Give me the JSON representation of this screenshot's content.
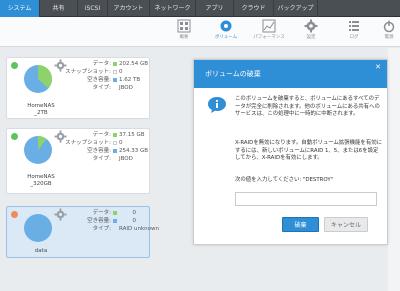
{
  "nav": {
    "tabs": [
      {
        "label": "システム",
        "active": true
      },
      {
        "label": "共有",
        "active": false
      },
      {
        "label": "iSCSI",
        "active": false
      },
      {
        "label": "アカウント",
        "active": false
      },
      {
        "label": "ネットワーク",
        "active": false
      },
      {
        "label": "アプリ",
        "active": false
      },
      {
        "label": "クラウド",
        "active": false
      },
      {
        "label": "バックアップ",
        "active": false
      }
    ]
  },
  "toolbar": {
    "items": [
      {
        "label": "概要",
        "icon": "overview-icon"
      },
      {
        "label": "ボリューム",
        "icon": "volume-icon",
        "active": true
      },
      {
        "label": "パフォーマンス",
        "icon": "performance-icon"
      },
      {
        "label": "設定",
        "icon": "settings-icon"
      },
      {
        "label": "ログ",
        "icon": "logs-icon"
      },
      {
        "label": "電源",
        "icon": "power-icon"
      }
    ]
  },
  "volumes": [
    {
      "name": "HomeNAS\n_2TB",
      "status_color": "#5cc45c",
      "stats": [
        {
          "label": "データ:",
          "value": "202.54 GB",
          "color": "#8ed26b"
        },
        {
          "label": "スナップショット:",
          "value": "0",
          "color": "#ffffff"
        },
        {
          "label": "空き容量:",
          "value": "1.62 TB",
          "color": "#6aaee6"
        },
        {
          "label": "タイプ:",
          "value": "JBOD",
          "color": ""
        }
      ]
    },
    {
      "name": "HomeNAS\n_320GB",
      "status_color": "#5cc45c",
      "stats": [
        {
          "label": "データ:",
          "value": "37.15 GB",
          "color": "#8ed26b"
        },
        {
          "label": "スナップショット:",
          "value": "0",
          "color": "#ffffff"
        },
        {
          "label": "空き容量:",
          "value": "254.33 GB",
          "color": "#6aaee6"
        },
        {
          "label": "タイプ:",
          "value": "JBOD",
          "color": ""
        }
      ]
    },
    {
      "name": "data",
      "status_color": "#f08a5d",
      "stats": [
        {
          "label": "データ:",
          "value": "0",
          "color": "#8ed26b"
        },
        {
          "label": "空き容量:",
          "value": "0",
          "color": "#6aaee6"
        },
        {
          "label": "タイプ:",
          "value": "RAID unknown",
          "color": ""
        }
      ]
    }
  ],
  "dialog": {
    "title": "ボリュームの破棄",
    "paragraphs": [
      "このボリュームを破棄すると、ボリュームにあるすべてのデータが完全に削除されます。他のボリュームにある共有へのサービスは、この処理中に一時的に中断されます。",
      "X-RAIDを無効になります。自動ボリューム拡張機能を有効にするには、新しいボリュームにRAID 1、5、または6を設定してから、X-RAIDを有効にします。",
      "次の値を入力してください: \"DESTROY\""
    ],
    "input_value": "",
    "ok_label": "破棄",
    "cancel_label": "キャンセル"
  },
  "colors": {
    "accent": "#2e8fd6",
    "nav_bg": "#4a4f54",
    "data": "#8ed26b",
    "free": "#6aaee6"
  }
}
